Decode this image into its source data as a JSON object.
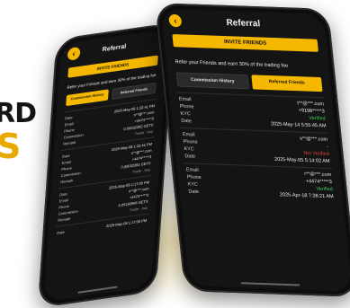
{
  "background": {
    "word_top": "RD",
    "word_bottom": "S"
  },
  "right_phone": {
    "back_icon": "back-arrow-icon",
    "title": "Referral",
    "banner": "INVITE FRIENDS",
    "promo": "Refer your Friends and earn 30% of the trading fee",
    "tabs": [
      {
        "label": "Commission History",
        "active": false
      },
      {
        "label": "Referred Friends",
        "active": true
      }
    ],
    "records": [
      {
        "email": "t**@***.com",
        "phone": "+9198*****3",
        "kyc": "Verified",
        "kyc_status": "ok",
        "date": "2025-May-14 5:55:45 AM"
      },
      {
        "email": "s**@***.com",
        "phone": "-",
        "kyc": "Not Verified",
        "kyc_status": "bad",
        "date": "2025-May-05 5:14:02 AM"
      },
      {
        "email": "r**@***.com",
        "phone": "+4474*****3",
        "kyc": "Verified",
        "kyc_status": "ok",
        "date": "2025-Apr-18 7:38:21 AM"
      }
    ],
    "field_labels": {
      "email": "Email",
      "phone": "Phone",
      "kyc": "KYC",
      "date": "Date"
    }
  },
  "left_phone": {
    "back_icon": "back-arrow-icon",
    "title": "Referral",
    "banner": "INVITE FRIENDS",
    "promo": "Refer your Friends and earn 30% of the trading fee",
    "tabs": [
      {
        "label": "Commission History",
        "active": true
      },
      {
        "label": "Referred Friends",
        "active": false
      }
    ],
    "records": [
      {
        "date": "2025-May-08 1:22:41 PM",
        "email": "n**@***.com",
        "phone": "+4474*****3",
        "commission": "0.00032262 GETX",
        "remark": "Trade - buy"
      },
      {
        "date": "2025-May-08 1:22:41 PM",
        "email": "n**@***.com",
        "phone": "+4474*****3",
        "commission": "0.00032262 GETX",
        "remark": "Trade - buy"
      },
      {
        "date": "2025-May-08 1:17:00 PM",
        "email": "n**@***.com",
        "phone": "+4474*****3",
        "commission": "0.05193996 GETX",
        "remark": "Trade - buy"
      },
      {
        "date": "2025-May-08 1:17:00 PM"
      }
    ],
    "field_labels": {
      "date": "Date",
      "email": "Email",
      "phone": "Phone",
      "commission": "Commission",
      "remark": "Remark"
    }
  }
}
